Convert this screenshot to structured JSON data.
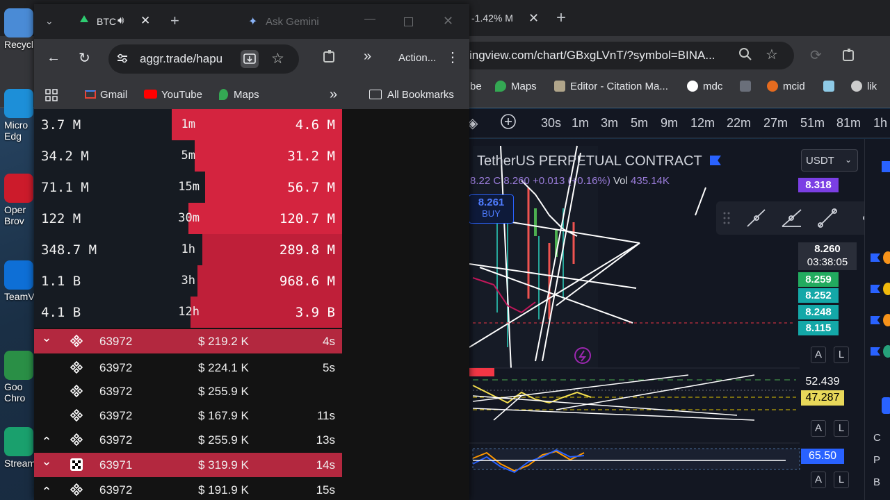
{
  "desktop": {
    "icons": [
      {
        "label": "Recycl",
        "color": "#4a8bd6"
      },
      {
        "label": "Micro",
        "label2": "Edg",
        "color": "#1d8fd8"
      },
      {
        "label": "Oper",
        "label2": "Brov",
        "color": "#cc1b2b"
      },
      {
        "label": "TeamV",
        "color": "#0e6fd6"
      },
      {
        "label": "Goo",
        "label2": "Chro",
        "color": "#2a8f46"
      },
      {
        "label": "Stream",
        "color": "#1aa06d"
      }
    ]
  },
  "tv_browser": {
    "tab_label": "-1.42% M",
    "url": "ingview.com/chart/GBxgLVnT/?symbol=BINA...",
    "bookmarks": [
      "be",
      "Maps",
      "Editor - Citation Ma...",
      "mdc",
      "",
      "mcid",
      "",
      "lik"
    ],
    "timeframes": [
      "30s",
      "1m",
      "3m",
      "5m",
      "9m",
      "12m",
      "22m",
      "27m",
      "51m",
      "81m",
      "1h"
    ],
    "chart_title": "TetherUS PERPETUAL CONTRACT",
    "ohlc_text": "8.22 C 8.260 +0.013 (+0.16%)",
    "vol_label": "Vol",
    "vol_value": "435.14K",
    "buy_price": "8.261",
    "buy_label": "BUY",
    "currency": "USDT",
    "price_tags": [
      {
        "value": "8.318",
        "color": "#7b3fe4"
      },
      {
        "value": "8.260",
        "color": "#2a2e39",
        "sub": "03:38:05"
      },
      {
        "value": "8.259",
        "color": "#22ab5f"
      },
      {
        "value": "8.252",
        "color": "#14a8a8"
      },
      {
        "value": "8.248",
        "color": "#14a8a8"
      },
      {
        "value": "8.115",
        "color": "#14a8a8"
      }
    ],
    "indicator_values": [
      {
        "value": "52.439",
        "bg": "#131722",
        "fg": "#ffffff"
      },
      {
        "value": "47.287",
        "bg": "#e8d85a",
        "fg": "#000000"
      },
      {
        "value": "65.50",
        "bg": "#2962ff",
        "fg": "#ffffff"
      }
    ],
    "al_labels": [
      "A",
      "L"
    ],
    "rightstrip_letters": [
      "C",
      "P",
      "B"
    ]
  },
  "aggr_browser": {
    "tab_label": "BTC",
    "gemini_label": "Ask Gemini",
    "url": "aggr.trade/hapu",
    "action_label": "Action...",
    "bookmarks": {
      "gmail": "Gmail",
      "youtube": "YouTube",
      "maps": "Maps",
      "all": "All Bookmarks"
    },
    "stats": [
      {
        "left": "3.7 M",
        "tf": "1m",
        "right": "4.6 M",
        "bar_from": 0.446
      },
      {
        "left": "34.2 M",
        "tf": "5m",
        "right": "31.2 M",
        "bar_from": 0.522
      },
      {
        "left": "71.1 M",
        "tf": "15m",
        "right": "56.7 M",
        "bar_from": 0.555
      },
      {
        "left": "122 M",
        "tf": "30m",
        "right": "120.7 M",
        "bar_from": 0.5
      },
      {
        "left": "348.7 M",
        "tf": "1h",
        "right": "289.8 M",
        "bar_from": 0.546
      },
      {
        "left": "1.1 B",
        "tf": "3h",
        "right": "968.6 M",
        "bar_from": 0.53
      },
      {
        "left": "4.1 B",
        "tf": "12h",
        "right": "3.9 B",
        "bar_from": 0.508
      }
    ],
    "trades": [
      {
        "side": "sell",
        "arrow": "⌄",
        "exchange": "binance",
        "price": "63972",
        "amount": "$ 219.2 K",
        "age": "4s"
      },
      {
        "side": "buy",
        "arrow": "",
        "exchange": "binance",
        "price": "63972",
        "amount": "$ 224.1 K",
        "age": "5s"
      },
      {
        "side": "buy",
        "arrow": "",
        "exchange": "binance",
        "price": "63972",
        "amount": "$ 255.9 K",
        "age": ""
      },
      {
        "side": "buy",
        "arrow": "",
        "exchange": "binance",
        "price": "63972",
        "amount": "$ 167.9 K",
        "age": "11s"
      },
      {
        "side": "buy",
        "arrow": "⌃",
        "exchange": "binance",
        "price": "63972",
        "amount": "$ 255.9 K",
        "age": "13s"
      },
      {
        "side": "sell",
        "arrow": "⌄",
        "exchange": "okx",
        "price": "63971",
        "amount": "$ 319.9 K",
        "age": "14s"
      },
      {
        "side": "buy",
        "arrow": "⌃",
        "exchange": "binance",
        "price": "63972",
        "amount": "$ 191.9 K",
        "age": "15s"
      }
    ]
  }
}
